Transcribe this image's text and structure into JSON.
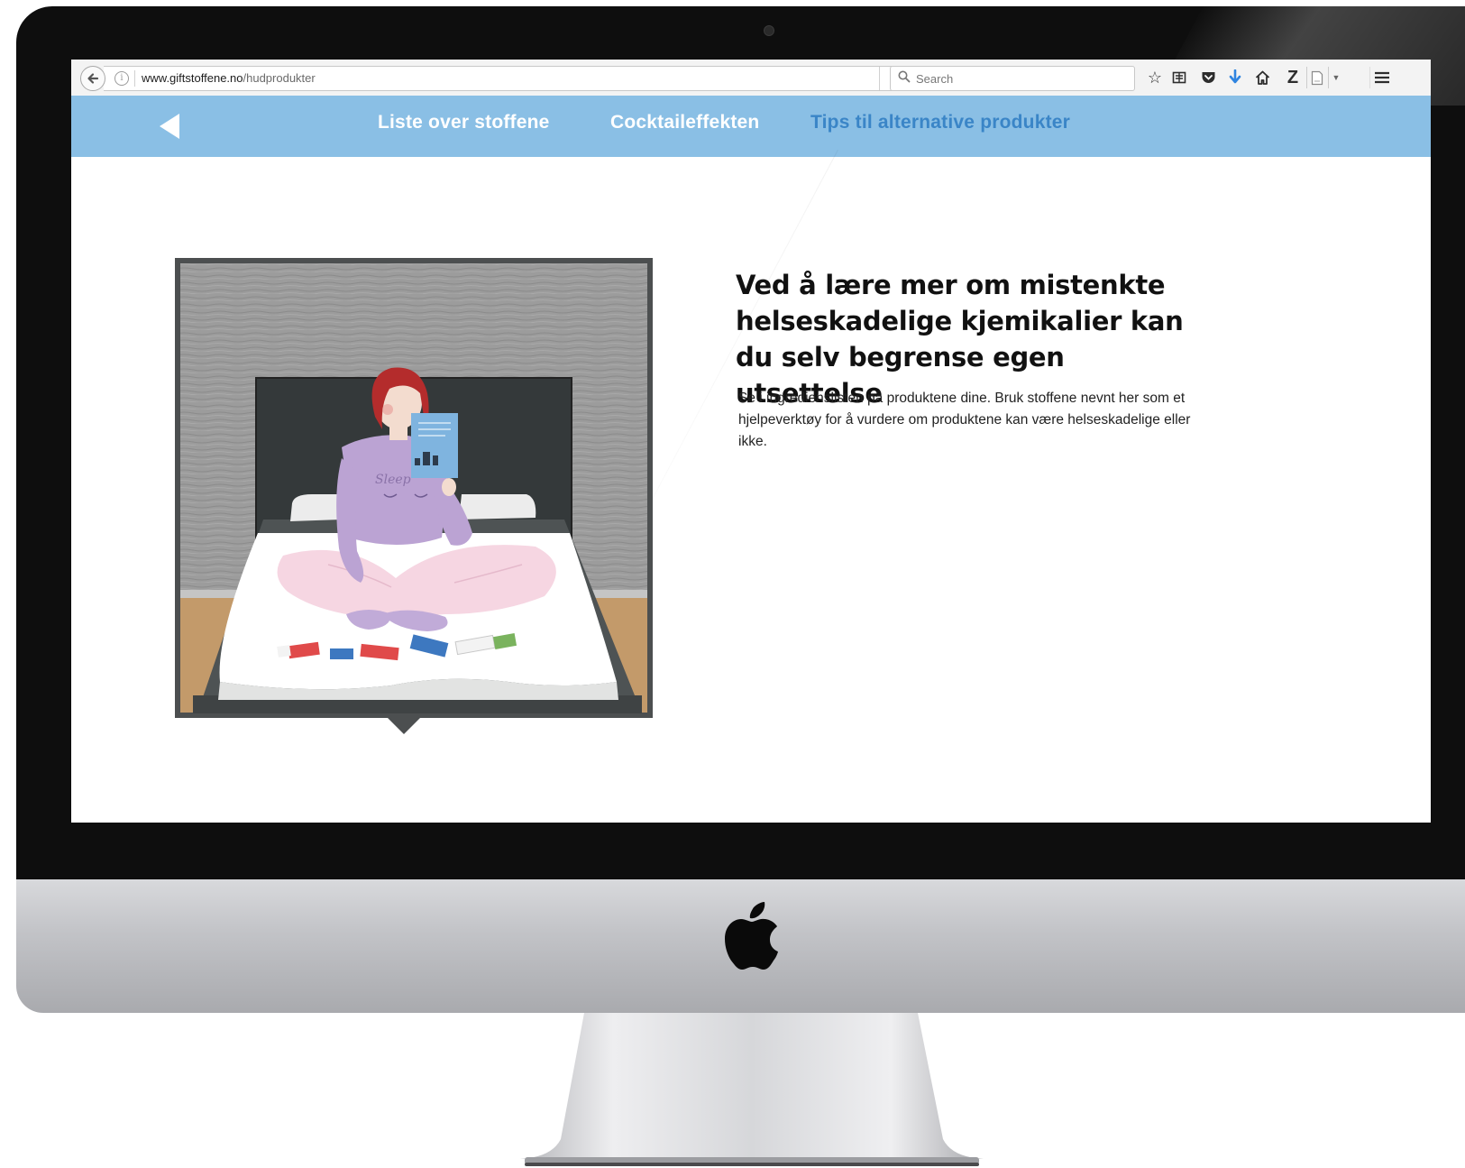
{
  "browser": {
    "url_host": "www.giftstoffene.no",
    "url_path": "/hudprodukter",
    "search_placeholder": "Search"
  },
  "nav": {
    "items": [
      {
        "label": "Liste over stoffene",
        "active": false
      },
      {
        "label": "Cocktaileffekten",
        "active": false
      },
      {
        "label": "Tips til alternative produkter",
        "active": true
      }
    ]
  },
  "content": {
    "headline": "Ved å lære mer om mistenkte helseskadelige kjemikalier kan du selv begrense egen utsettelse",
    "body": "Se i ingredienslisten på produktene dine. Bruk stoffene nevnt her som et hjelpeverktøy for å vurdere om produktene kan være helseskadelige eller ikke."
  },
  "illustration": {
    "shirt_text": "Sleep"
  },
  "colors": {
    "nav_bg": "#8abfe5",
    "nav_active": "#3a85c7",
    "nav_text": "#ffffff"
  },
  "icons": [
    "back-arrow-icon",
    "info-icon",
    "reload-icon",
    "search-icon",
    "bookmark-star-icon",
    "reading-list-icon",
    "pocket-icon",
    "download-icon",
    "home-icon",
    "zotero-icon",
    "page-icon",
    "dropdown-icon",
    "menu-icon",
    "apple-logo-icon"
  ]
}
